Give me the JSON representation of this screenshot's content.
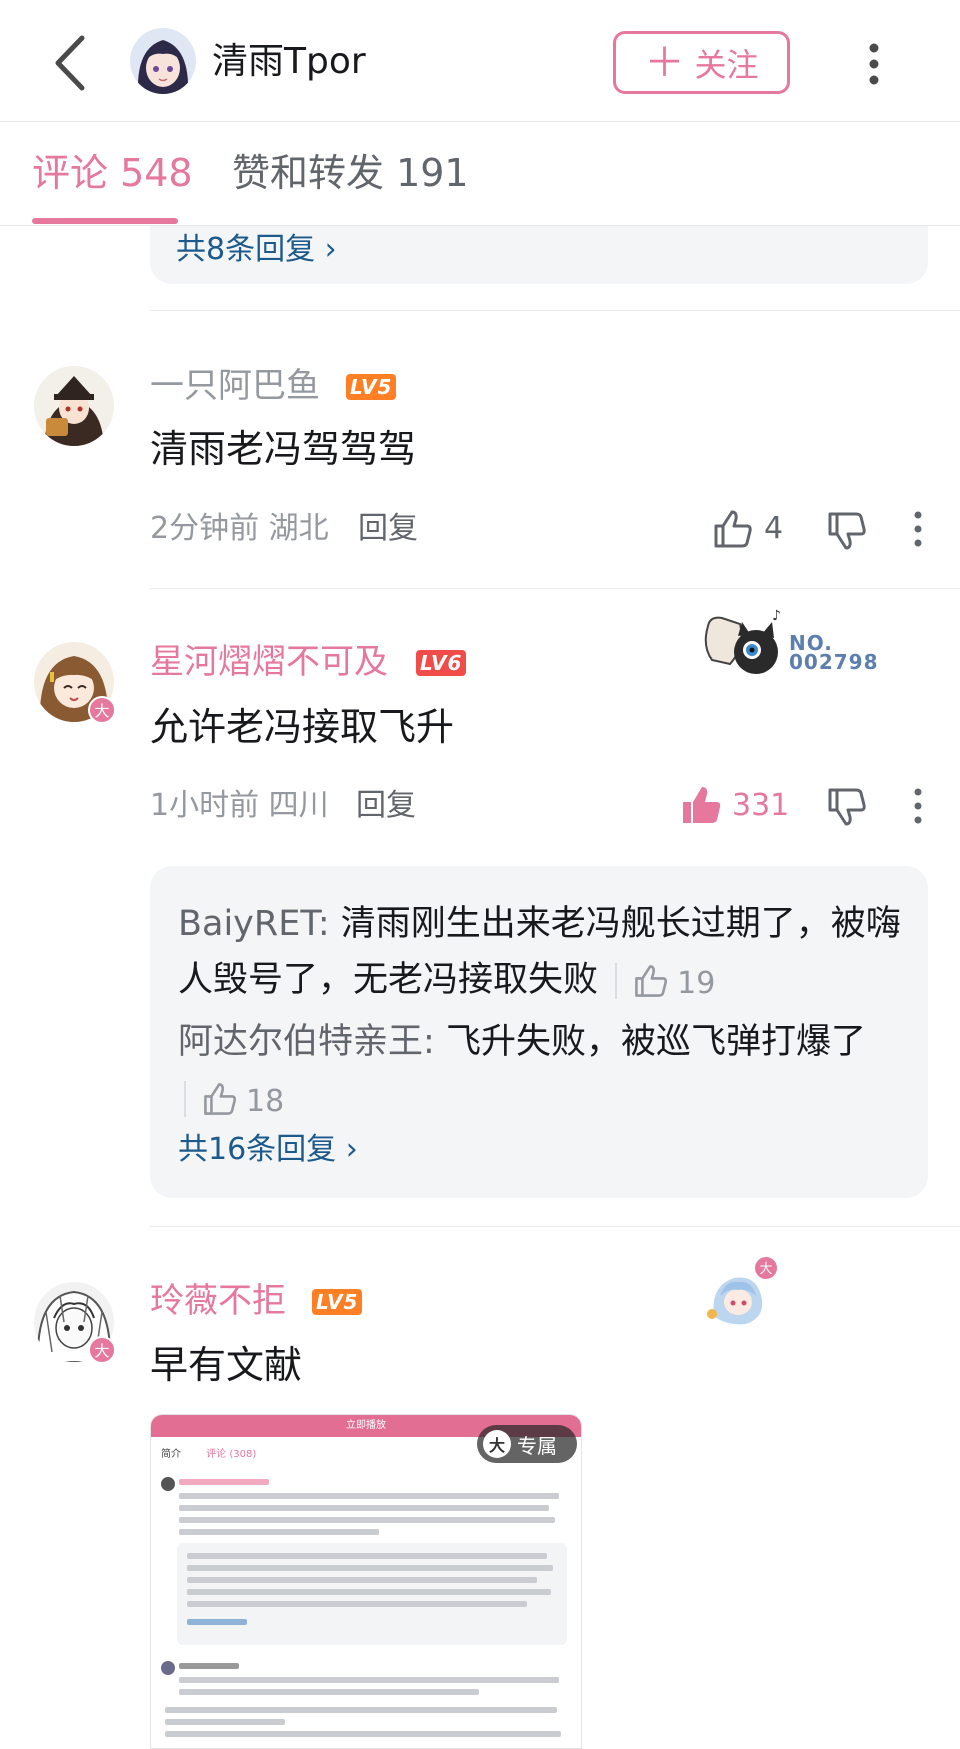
{
  "header": {
    "up_name": "清雨Tpor",
    "follow_label": "关注",
    "follow_plus": "＋"
  },
  "tabs": {
    "comments_label": "评论 548",
    "likes_label": "赞和转发 191"
  },
  "previous_thread": {
    "more_replies": "共8条回复 ›"
  },
  "comments": [
    {
      "user": "一只阿巴鱼",
      "level": "LV5",
      "text": "清雨老冯驾驾驾",
      "time_location": "2分钟前 湖北",
      "reply_label": "回复",
      "likes": "4"
    },
    {
      "user": "星河熠熠不可及",
      "level": "LV6",
      "badge": "大",
      "fan_number": "NO.\n002798",
      "text": "允许老冯接取飞升",
      "time_location": "1小时前 四川",
      "reply_label": "回复",
      "likes": "331",
      "replies": [
        {
          "author": "BaiyRET:",
          "text": "清雨刚生出来老冯舰长过期了，被嗨人毁号了，无老冯接取失败",
          "likes": "19"
        },
        {
          "author": "阿达尔伯特亲王:",
          "text": "飞升失败，被巡飞弹打爆了",
          "likes": "18"
        }
      ],
      "more_replies": "共16条回复 ›"
    },
    {
      "user": "玲薇不拒",
      "level": "LV5",
      "badge": "大",
      "text": "早有文献",
      "image_badge": "专属",
      "image_badge_icon": "大"
    }
  ],
  "embedded_screenshot": {
    "bar_text": "立即播放",
    "tab_intro": "简介",
    "tab_comments": "评论 (308)"
  },
  "colors": {
    "accent_pink": "#e5789c",
    "link_blue": "#1c5a8c",
    "level5": "#ff7f24",
    "level6": "#f04c49"
  }
}
